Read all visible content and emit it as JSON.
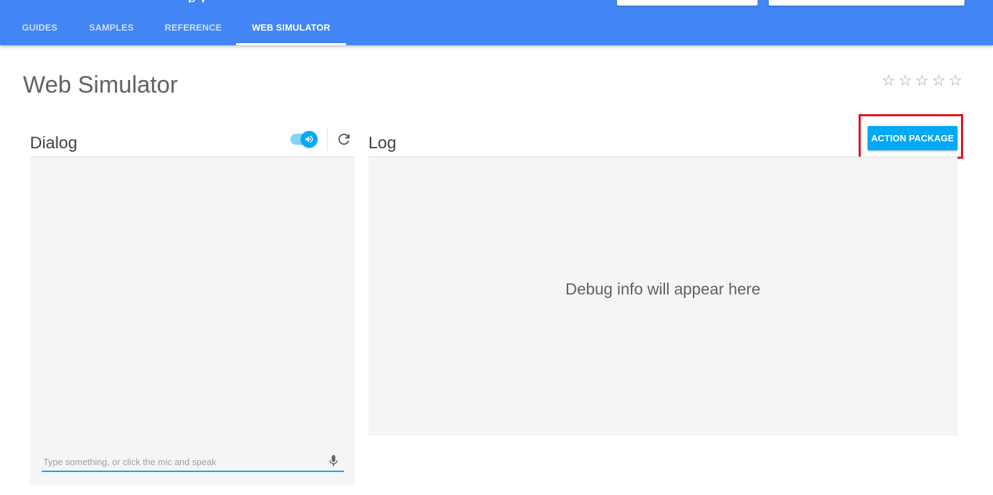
{
  "header": {
    "title_fragment": "p    y",
    "tabs": [
      {
        "label": "GUIDES"
      },
      {
        "label": "SAMPLES"
      },
      {
        "label": "REFERENCE"
      },
      {
        "label": "WEB SIMULATOR",
        "active": true
      }
    ]
  },
  "page": {
    "title": "Web Simulator",
    "rating": {
      "stars": 5,
      "filled": 0,
      "icon": "star-outline-icon"
    }
  },
  "toolbar": {
    "action_package_label": "ACTION PACKAGE"
  },
  "dialog": {
    "label": "Dialog",
    "audio_toggle_on": true,
    "input_value": "",
    "input_placeholder": "Type something, or click the mic and speak"
  },
  "log": {
    "label": "Log",
    "empty_message": "Debug info will appear here"
  },
  "colors": {
    "header_bg": "#4285f4",
    "accent": "#03a9f4",
    "highlight": "#e0111f",
    "panel_bg": "#f5f5f5"
  }
}
